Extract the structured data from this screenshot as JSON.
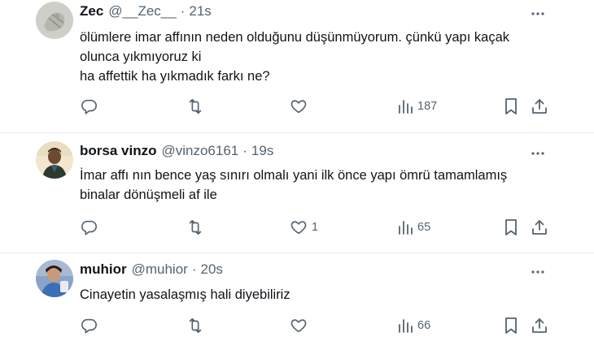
{
  "tweets": [
    {
      "name": "Zec",
      "handle": "@__Zec__",
      "separator": "·",
      "time": "21s",
      "lines": [
        "ölümlere imar affının neden olduğunu düşünmüyorum. çünkü yapı kaçak",
        "olunca yıkmıyoruz ki",
        "ha affettik ha yıkmadık farkı ne?"
      ],
      "likes": "",
      "views": "187"
    },
    {
      "name": "borsa vinzo",
      "handle": "@vinzo6161",
      "separator": "·",
      "time": "19s",
      "lines": [
        "İmar affı nın bence yaş sınırı olmalı yani ilk önce yapı ömrü tamamlamış",
        "binalar dönüşmeli af ile"
      ],
      "likes": "1",
      "views": "65"
    },
    {
      "name": "muhior",
      "handle": "@muhior",
      "separator": "·",
      "time": "20s",
      "lines": [
        "Cinayetin yasalaşmış hali diyebiliriz"
      ],
      "likes": "",
      "views": "66"
    }
  ],
  "icons": {
    "reply": "reply-icon",
    "retweet": "retweet-icon",
    "like": "heart-icon",
    "views": "views-icon",
    "bookmark": "bookmark-icon",
    "share": "share-icon",
    "more": "more-icon"
  },
  "colors": {
    "text": "#0f1419",
    "secondary": "#536471",
    "divider": "#e6ecf0"
  }
}
